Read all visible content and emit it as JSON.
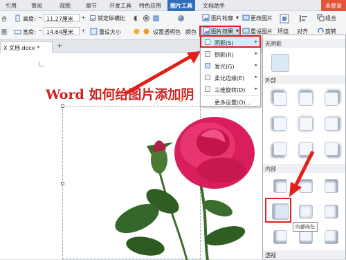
{
  "tabs": [
    "引用",
    "审阅",
    "视图",
    "章节",
    "开发工具",
    "特色应用",
    "图片工具",
    "文档助手"
  ],
  "login": "未登录",
  "ribbon": {
    "height_label": "高度:",
    "height_value": "11.27厘米",
    "width_label": "宽度:",
    "width_value": "14.64厘米",
    "lock_ratio": "锁定纵横比",
    "reset_size": "重设大小",
    "set_transparent": "设置透明色",
    "color": "颜色",
    "left_label_1": "合",
    "left_label_2": "图",
    "picture_outline": "图片轮廓",
    "picture_effect": "图片效果",
    "change_picture": "更改图片",
    "reset_picture": "重设图片",
    "wrap": "环绕",
    "align": "对齐",
    "combine": "组合",
    "rotate": "旋转"
  },
  "document": {
    "tab_title": "X 文档.docx *",
    "heading": "Word 如何给图片添加阴"
  },
  "menu": {
    "items": [
      {
        "label": "阴影(S)",
        "icon": "shadow-icon"
      },
      {
        "label": "倒影(R)",
        "icon": "reflection-icon"
      },
      {
        "label": "发光(G)",
        "icon": "glow-icon"
      },
      {
        "label": "柔化边缘(E)",
        "icon": "soft-edge-icon"
      },
      {
        "label": "三维旋转(D)",
        "icon": "3d-rotation-icon"
      }
    ],
    "more": "更多设置(O)..."
  },
  "gallery": {
    "sections": [
      "无阴影",
      "外部",
      "内部",
      "透视"
    ],
    "tooltip": "内部向左"
  },
  "colors": {
    "accent": "#2f6fba",
    "login": "#e3543b",
    "heading": "#d11f1f",
    "highlight": "#e0201a"
  }
}
